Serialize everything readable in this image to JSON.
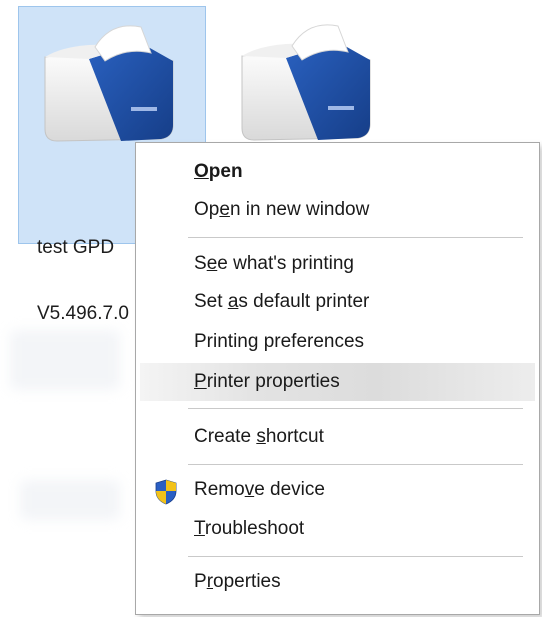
{
  "desktop": {
    "items": [
      {
        "label_line1": "test GPD",
        "label_line2": "V5.496.7.0",
        "selected": true
      },
      {
        "label_line1": "",
        "label_line2": "",
        "selected": false
      }
    ]
  },
  "context_menu": {
    "items": [
      {
        "id": "open",
        "pre": "",
        "key": "O",
        "post": "pen",
        "bold": true
      },
      {
        "id": "open-new-window",
        "pre": "Op",
        "key": "e",
        "post": "n in new window"
      },
      {
        "id": "see-printing",
        "pre": "S",
        "key": "e",
        "post": "e what's printing"
      },
      {
        "id": "set-default",
        "pre": "Set ",
        "key": "a",
        "post": "s default printer"
      },
      {
        "id": "printing-prefs",
        "pre": "Printin",
        "key": "g",
        "post": " preferences"
      },
      {
        "id": "printer-props",
        "pre": "",
        "key": "P",
        "post": "rinter properties",
        "hover": true
      },
      {
        "id": "create-shortcut",
        "pre": "Create ",
        "key": "s",
        "post": "hortcut"
      },
      {
        "id": "remove-device",
        "pre": "Remo",
        "key": "v",
        "post": "e device",
        "icon": "uac-shield-icon"
      },
      {
        "id": "troubleshoot",
        "pre": "",
        "key": "T",
        "post": "roubleshoot"
      },
      {
        "id": "properties",
        "pre": "P",
        "key": "r",
        "post": "operties"
      }
    ]
  },
  "colors": {
    "selection_bg": "#cfe3f8",
    "selection_border": "#9ec5ec",
    "printer_blue": "#1f4fa3",
    "menu_hover": "#dcdcdc"
  }
}
